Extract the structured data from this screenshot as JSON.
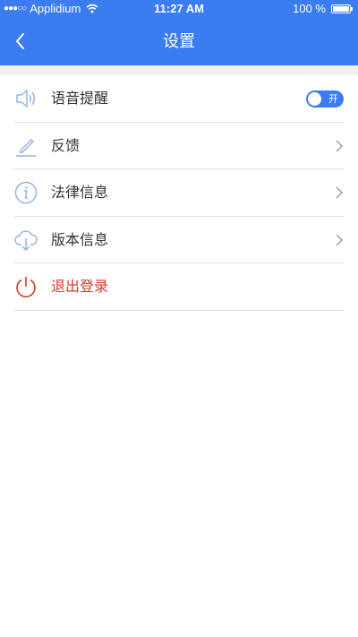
{
  "status_bar": {
    "signal_dots": "●●●○○",
    "carrier": "Applidium",
    "time": "11:27 AM",
    "battery_text": "100 %"
  },
  "header": {
    "back_icon": "chevron-left-icon",
    "title": "设置"
  },
  "settings": {
    "voice_reminder": {
      "label": "语音提醒",
      "icon": "speaker-icon",
      "toggle_label": "开",
      "enabled": true
    },
    "feedback": {
      "label": "反馈",
      "icon": "pencil-icon"
    },
    "legal_info": {
      "label": "法律信息",
      "icon": "info-icon"
    },
    "version_info": {
      "label": "版本信息",
      "icon": "download-icon"
    },
    "logout": {
      "label": "退出登录",
      "icon": "power-icon"
    }
  },
  "colors": {
    "primary": "#3b7cf0",
    "icon_blue": "#8fb0e6",
    "logout_red": "#d03a2b",
    "divider": "#dfdfe2"
  }
}
